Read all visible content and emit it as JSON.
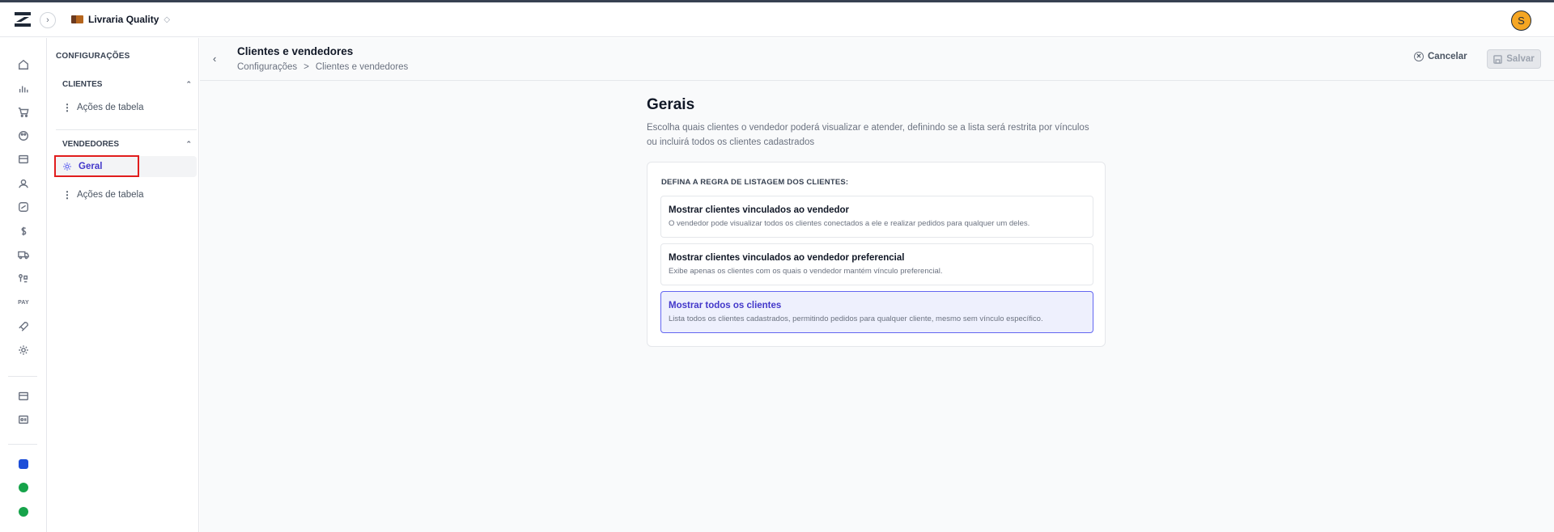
{
  "header": {
    "store_name": "Livraria Quality",
    "avatar_initial": "S"
  },
  "rail": {
    "icons": [
      "home-icon",
      "chart-icon",
      "cart-icon",
      "palette-icon",
      "box-icon",
      "users-icon",
      "exchange-icon",
      "dollar-icon",
      "truck-icon",
      "route-icon",
      "pay-icon",
      "rocket-icon",
      "gear-icon",
      "store-icon",
      "id-card-icon",
      "app-badge-icon",
      "whatsapp-icon",
      "whatsapp-icon"
    ],
    "pay_label": "PAY"
  },
  "settings_sidebar": {
    "title": "CONFIGURAÇÕES",
    "groups": [
      {
        "label": "CLIENTES",
        "items": [
          {
            "label": "Ações de tabela"
          }
        ]
      },
      {
        "label": "VENDEDORES",
        "items": [
          {
            "label": "Geral",
            "active": true
          },
          {
            "label": "Ações de tabela"
          }
        ]
      }
    ]
  },
  "page": {
    "title": "Clientes e vendedores",
    "breadcrumb": [
      "Configurações",
      ">",
      "Clientes e vendedores"
    ],
    "cancel_label": "Cancelar",
    "save_label": "Salvar"
  },
  "section": {
    "title": "Gerais",
    "description": "Escolha quais clientes o vendedor poderá visualizar e atender, definindo se a lista será restrita por vínculos ou incluirá todos os clientes cadastrados",
    "card_label": "DEFINA A REGRA DE LISTAGEM DOS CLIENTES:",
    "options": [
      {
        "title": "Mostrar clientes vinculados ao vendedor",
        "description": "O vendedor pode visualizar todos os clientes conectados a ele e realizar pedidos para qualquer um deles.",
        "selected": false
      },
      {
        "title": "Mostrar clientes vinculados ao vendedor preferencial",
        "description": "Exibe apenas os clientes com os quais o vendedor mantém vínculo preferencial.",
        "selected": false
      },
      {
        "title": "Mostrar todos os clientes",
        "description": "Lista todos os clientes cadastrados, permitindo pedidos para qualquer cliente, mesmo sem vínculo específico.",
        "selected": true
      }
    ]
  },
  "colors": {
    "accent": "#4338ca",
    "selected_bg": "#eef0fd",
    "highlight": "#e11d1d",
    "avatar": "#f5a623"
  }
}
